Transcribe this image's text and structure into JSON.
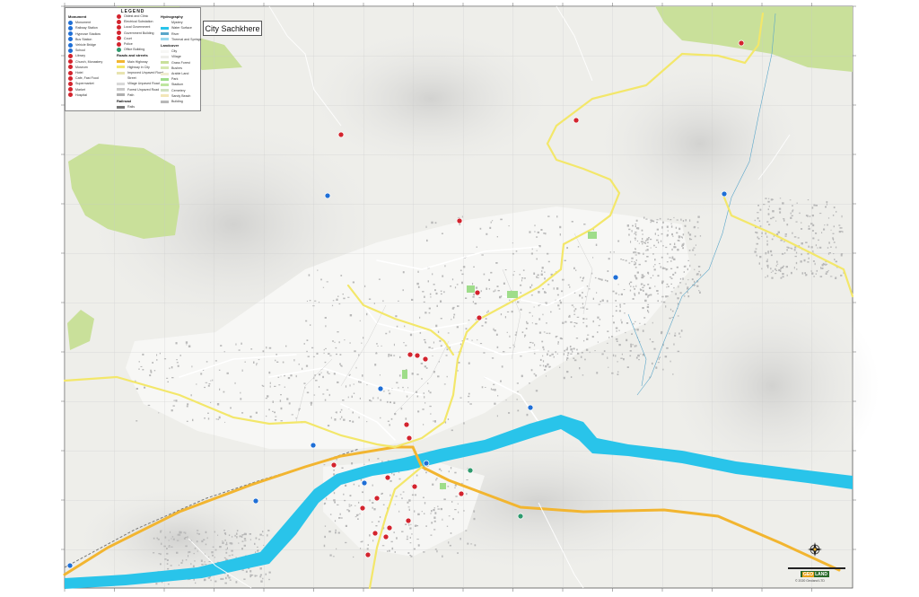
{
  "map": {
    "title": "City Sachkhere",
    "colors": {
      "base": "#f2f2ee",
      "forest": "#c9e09a",
      "river": "#29c4ea",
      "highway": "#f2b530",
      "main_road": "#f3e76a",
      "poi_red": "#d3242e",
      "poi_blue": "#1f6fd6",
      "poi_green": "#2e9a6e"
    }
  },
  "legend": {
    "title": "LEGEND",
    "monument": {
      "heading": "Monument",
      "items": [
        "Monument",
        "Railway Station",
        "Hypnose Stadiow",
        "Bus Station",
        "Vehicle Bridge",
        "School",
        "Library",
        "Church, Monastery",
        "Museum",
        "Hotel",
        "Cafe, Fast Food",
        "Supermarket",
        "Market",
        "Hospital"
      ]
    },
    "services": {
      "items": [
        "Oldest and Clinic",
        "Electrical Substation",
        "Local Government",
        "Government Building",
        "Court",
        "Police",
        "Office Building"
      ]
    },
    "roads": {
      "heading": "Roads and streets",
      "items": [
        "Main Highway",
        "Highway in City",
        "Improved Unpaved Road",
        "Street",
        "Village Unpaved Road",
        "Forest Unpaved Road",
        "Path"
      ]
    },
    "railroad": {
      "heading": "Railroad",
      "items": [
        "Rails"
      ]
    },
    "hydrography": {
      "heading": "Hydrography",
      "items": [
        "Mystery",
        "Water Surface",
        "River",
        "Thermal and Springs"
      ]
    },
    "landcover": {
      "heading": "Landcover",
      "items": [
        "City",
        "Village",
        "Grass Forest",
        "Bushes",
        "Arable Land",
        "Park",
        "Stadium",
        "Cemetery",
        "Sandy Beach",
        "Building"
      ]
    }
  },
  "logo": {
    "brand_left": "GEO",
    "brand_right": "LAND",
    "copyright": "© 2020 Geoland LTD"
  }
}
